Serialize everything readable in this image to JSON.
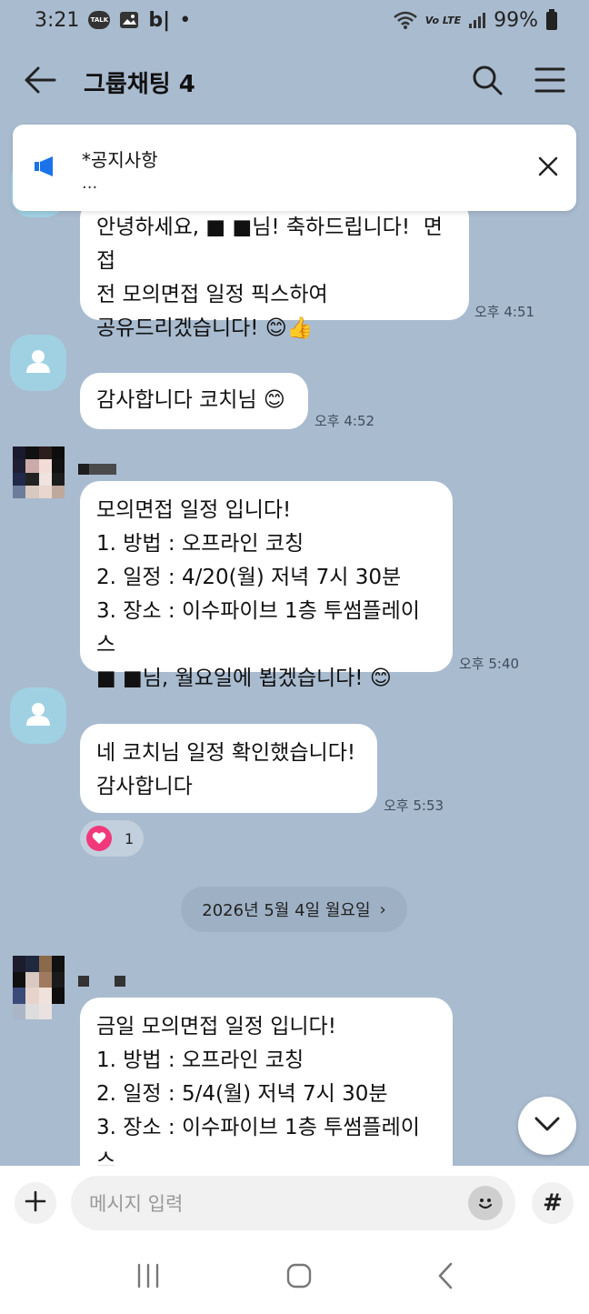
{
  "status_bar": {
    "time": "3:21",
    "app_indicator": "b|",
    "dot": "•",
    "battery": "99%",
    "icons": [
      "talk-notification-icon",
      "image-notification-icon",
      "wifi-icon",
      "volte-icon",
      "signal-icon",
      "battery-icon"
    ]
  },
  "header": {
    "title": "그룹채팅 4"
  },
  "notice": {
    "title": "*공지사항",
    "detail": "..."
  },
  "messages": [
    {
      "text": "안녕하세요, ■ ■님! 축하드립니다!  면접\n전 모의면접 일정 픽스하여\n공유드리겠습니다! 😊👍",
      "time": "오후 4:51"
    },
    {
      "text": "감사합니다 코치님 😊",
      "time": "오후 4:52"
    },
    {
      "text": "모의면접 일정 입니다!\n1. 방법 : 오프라인 코칭\n2. 일정 : 4/20(월) 저녁 7시 30분\n3. 장소 : 이수파이브 1층 투썸플레이스\n■ ■님, 월요일에 뵙겠습니다! 😊",
      "time": "오후 5:40"
    },
    {
      "text": "네 코치님 일정 확인했습니다!\n감사합니다",
      "time": "오후 5:53"
    },
    {
      "text": "금일 모의면접 일정 입니다!\n1. 방법 : 오프라인 코칭\n2. 일정 : 5/4(월) 저녁 7시 30분\n3. 장소 : 이수파이브 1층 투썸플레이스\n■ ■님, 있다 뵙겠습니다! 😊",
      "time": ""
    }
  ],
  "reaction": {
    "count": "1"
  },
  "date_divider": {
    "label": "2026년 5월 4일 월요일",
    "chevron": "›"
  },
  "input": {
    "placeholder": "메시지 입력",
    "hash": "#"
  },
  "colors": {
    "chat_background": "#a9bbcf",
    "bubble": "#ffffff",
    "notice_icon": "#1a73e8",
    "heart": "#f0387a",
    "date_chip": "#9eb0c4"
  }
}
